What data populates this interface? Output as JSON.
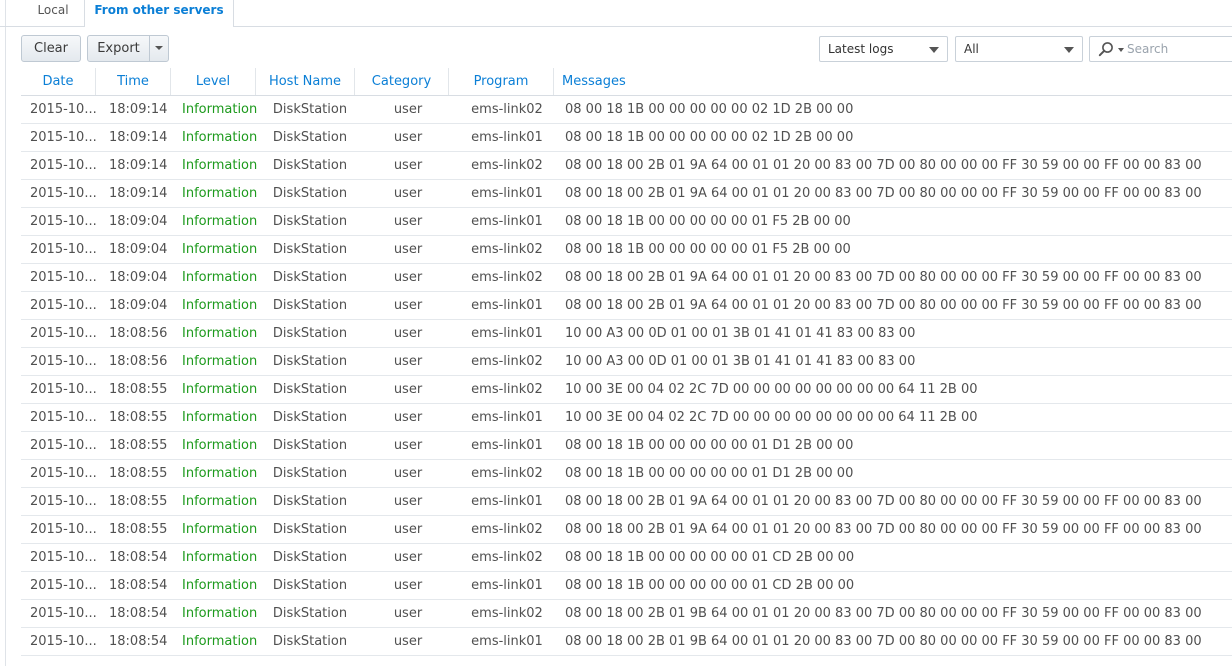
{
  "tabs": {
    "local": "Local",
    "other": "From other servers"
  },
  "toolbar": {
    "clear": "Clear",
    "export": "Export",
    "log_filter": "Latest logs",
    "level_filter": "All",
    "search_placeholder": "Search"
  },
  "columns": {
    "date": "Date",
    "time": "Time",
    "level": "Level",
    "host": "Host Name",
    "category": "Category",
    "program": "Program",
    "messages": "Messages"
  },
  "colors": {
    "accent": "#0b7fd6",
    "level_info": "#1d9a1d"
  },
  "rows": [
    {
      "date": "2015-10...",
      "time": "18:09:14",
      "level": "Information",
      "host": "DiskStation",
      "category": "user",
      "program": "ems-link02",
      "message": "08 00 18 1B 00 00 00 00 00 02 1D 2B 00 00"
    },
    {
      "date": "2015-10...",
      "time": "18:09:14",
      "level": "Information",
      "host": "DiskStation",
      "category": "user",
      "program": "ems-link01",
      "message": "08 00 18 1B 00 00 00 00 00 02 1D 2B 00 00"
    },
    {
      "date": "2015-10...",
      "time": "18:09:14",
      "level": "Information",
      "host": "DiskStation",
      "category": "user",
      "program": "ems-link02",
      "message": "08 00 18 00 2B 01 9A 64 00 01 01 20 00 83 00 7D 00 80 00 00 00 FF 30 59 00 00 FF 00 00 83 00"
    },
    {
      "date": "2015-10...",
      "time": "18:09:14",
      "level": "Information",
      "host": "DiskStation",
      "category": "user",
      "program": "ems-link01",
      "message": "08 00 18 00 2B 01 9A 64 00 01 01 20 00 83 00 7D 00 80 00 00 00 FF 30 59 00 00 FF 00 00 83 00"
    },
    {
      "date": "2015-10...",
      "time": "18:09:04",
      "level": "Information",
      "host": "DiskStation",
      "category": "user",
      "program": "ems-link01",
      "message": "08 00 18 1B 00 00 00 00 00 01 F5 2B 00 00"
    },
    {
      "date": "2015-10...",
      "time": "18:09:04",
      "level": "Information",
      "host": "DiskStation",
      "category": "user",
      "program": "ems-link02",
      "message": "08 00 18 1B 00 00 00 00 00 01 F5 2B 00 00"
    },
    {
      "date": "2015-10...",
      "time": "18:09:04",
      "level": "Information",
      "host": "DiskStation",
      "category": "user",
      "program": "ems-link02",
      "message": "08 00 18 00 2B 01 9A 64 00 01 01 20 00 83 00 7D 00 80 00 00 00 FF 30 59 00 00 FF 00 00 83 00"
    },
    {
      "date": "2015-10...",
      "time": "18:09:04",
      "level": "Information",
      "host": "DiskStation",
      "category": "user",
      "program": "ems-link01",
      "message": "08 00 18 00 2B 01 9A 64 00 01 01 20 00 83 00 7D 00 80 00 00 00 FF 30 59 00 00 FF 00 00 83 00"
    },
    {
      "date": "2015-10...",
      "time": "18:08:56",
      "level": "Information",
      "host": "DiskStation",
      "category": "user",
      "program": "ems-link01",
      "message": "10 00 A3 00 0D 01 00 01 3B 01 41 01 41 83 00 83 00"
    },
    {
      "date": "2015-10...",
      "time": "18:08:56",
      "level": "Information",
      "host": "DiskStation",
      "category": "user",
      "program": "ems-link02",
      "message": "10 00 A3 00 0D 01 00 01 3B 01 41 01 41 83 00 83 00"
    },
    {
      "date": "2015-10...",
      "time": "18:08:55",
      "level": "Information",
      "host": "DiskStation",
      "category": "user",
      "program": "ems-link02",
      "message": "10 00 3E 00 04 02 2C 7D 00 00 00 00 00 00 00 00 64 11 2B 00"
    },
    {
      "date": "2015-10...",
      "time": "18:08:55",
      "level": "Information",
      "host": "DiskStation",
      "category": "user",
      "program": "ems-link01",
      "message": "10 00 3E 00 04 02 2C 7D 00 00 00 00 00 00 00 00 64 11 2B 00"
    },
    {
      "date": "2015-10...",
      "time": "18:08:55",
      "level": "Information",
      "host": "DiskStation",
      "category": "user",
      "program": "ems-link01",
      "message": "08 00 18 1B 00 00 00 00 00 01 D1 2B 00 00"
    },
    {
      "date": "2015-10...",
      "time": "18:08:55",
      "level": "Information",
      "host": "DiskStation",
      "category": "user",
      "program": "ems-link02",
      "message": "08 00 18 1B 00 00 00 00 00 01 D1 2B 00 00"
    },
    {
      "date": "2015-10...",
      "time": "18:08:55",
      "level": "Information",
      "host": "DiskStation",
      "category": "user",
      "program": "ems-link01",
      "message": "08 00 18 00 2B 01 9A 64 00 01 01 20 00 83 00 7D 00 80 00 00 00 FF 30 59 00 00 FF 00 00 83 00"
    },
    {
      "date": "2015-10...",
      "time": "18:08:55",
      "level": "Information",
      "host": "DiskStation",
      "category": "user",
      "program": "ems-link02",
      "message": "08 00 18 00 2B 01 9A 64 00 01 01 20 00 83 00 7D 00 80 00 00 00 FF 30 59 00 00 FF 00 00 83 00"
    },
    {
      "date": "2015-10...",
      "time": "18:08:54",
      "level": "Information",
      "host": "DiskStation",
      "category": "user",
      "program": "ems-link02",
      "message": "08 00 18 1B 00 00 00 00 00 01 CD 2B 00 00"
    },
    {
      "date": "2015-10...",
      "time": "18:08:54",
      "level": "Information",
      "host": "DiskStation",
      "category": "user",
      "program": "ems-link01",
      "message": "08 00 18 1B 00 00 00 00 00 01 CD 2B 00 00"
    },
    {
      "date": "2015-10...",
      "time": "18:08:54",
      "level": "Information",
      "host": "DiskStation",
      "category": "user",
      "program": "ems-link02",
      "message": "08 00 18 00 2B 01 9B 64 00 01 01 20 00 83 00 7D 00 80 00 00 00 FF 30 59 00 00 FF 00 00 83 00"
    },
    {
      "date": "2015-10...",
      "time": "18:08:54",
      "level": "Information",
      "host": "DiskStation",
      "category": "user",
      "program": "ems-link01",
      "message": "08 00 18 00 2B 01 9B 64 00 01 01 20 00 83 00 7D 00 80 00 00 00 FF 30 59 00 00 FF 00 00 83 00"
    }
  ]
}
